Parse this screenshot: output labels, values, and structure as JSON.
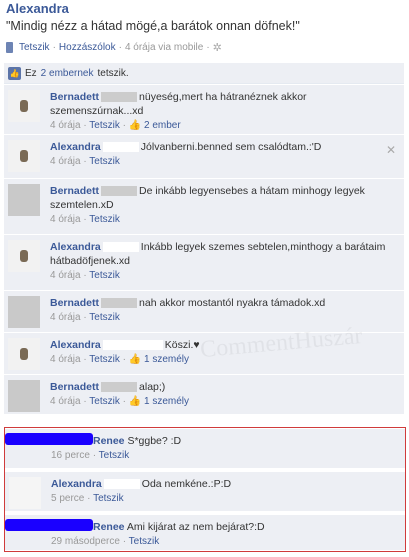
{
  "post": {
    "author": "Alexandra",
    "status": "\"Mindig nézz a hátad mögé,a barátok onnan döfnek!\"",
    "like_label": "Tetszik",
    "comment_label": "Hozzászólok",
    "time": "4 órája via mobile"
  },
  "likes": {
    "text_prefix": "Ez",
    "count_link": "2 embernek",
    "text_suffix": "tetszik."
  },
  "comments": [
    {
      "name": "Bernadett",
      "text": "nüyeség,mert ha hátranéznek akkor szemenszúrnak...xd",
      "time": "4 órája",
      "like": "Tetszik",
      "like_count": "2 ember"
    },
    {
      "name": "Alexandra",
      "text": "Jólvanberni.benned sem csalódtam.:'D",
      "time": "4 órája",
      "like": "Tetszik",
      "like_count": ""
    },
    {
      "name": "Bernadett",
      "text": "De inkább legyensebes a hátam minhogy legyek szemtelen.xD",
      "time": "4 órája",
      "like": "Tetszik",
      "like_count": ""
    },
    {
      "name": "Alexandra",
      "text": "Inkább legyek szemes sebtelen,minthogy a barátaim hátbadöfjenek.xd",
      "time": "4 órája",
      "like": "Tetszik",
      "like_count": ""
    },
    {
      "name": "Bernadett",
      "text": "nah akkor mostantól nyakra támadok.xd",
      "time": "4 órája",
      "like": "Tetszik",
      "like_count": ""
    },
    {
      "name": "Alexandra",
      "text": "Köszi.♥",
      "time": "4 órája",
      "like": "Tetszik",
      "like_count": "1 személy"
    },
    {
      "name": "Bernadett",
      "text": "alap;)",
      "time": "4 órája",
      "like": "Tetszik",
      "like_count": "1 személy"
    }
  ],
  "recent": [
    {
      "name": "Renee",
      "text": "S*ggbe? :D",
      "time": "16 perce",
      "like": "Tetszik"
    },
    {
      "name": "Alexandra",
      "text": "Oda nemkéne.:P:D",
      "time": "5 perce",
      "like": "Tetszik"
    },
    {
      "name": "Renee",
      "text": "Ami kijárat az nem bejárat?:D",
      "time": "29 másodperce",
      "like": "Tetszik"
    }
  ],
  "watermark": "CommentHuszár"
}
